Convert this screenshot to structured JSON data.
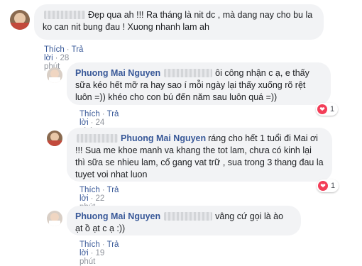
{
  "comments": [
    {
      "author": "",
      "text": "Đẹp qua ah !!! Ra tháng là nit dc , mà dang nay cho bu la ko can nit bung đau ! Xuong nhanh lam ah",
      "like_label": "Thích",
      "reply_label": "Trả lời",
      "time": "28 phút"
    },
    {
      "author": "Phuong Mai Nguyen",
      "text": "ôi công nhận c ạ, e thấy sữa kéo hết mỡ ra hay sao í mỗi ngày lại thấy xuống rõ rệt luôn =)) khéo cho con bú đến năm sau luôn quá =))",
      "like_label": "Thích",
      "reply_label": "Trả lời",
      "time": "24 phút",
      "reaction_count": "1"
    },
    {
      "tag": "Phuong Mai Nguyen",
      "text": "ráng cho hết 1 tuổi đi Mai ơi !!! Sua me khoe manh va khang the tot lam, chưa có kinh lại thì sữa se nhieu lam, cố gang vat trữ , sua trong 3 thang đau la tuyet voi nhat luon",
      "like_label": "Thích",
      "reply_label": "Trả lời",
      "time": "22 phút",
      "reaction_count": "1"
    },
    {
      "author": "Phuong Mai Nguyen",
      "text": "vâng cứ gọi là ào ạt ồ ạt c ạ :))",
      "like_label": "Thích",
      "reply_label": "Trả lời",
      "time": "19 phút"
    }
  ],
  "colors": {
    "author": "#385898",
    "bubble": "#f2f3f5",
    "heart": "#f33e58"
  },
  "icons": {
    "reaction": "heart-icon"
  }
}
